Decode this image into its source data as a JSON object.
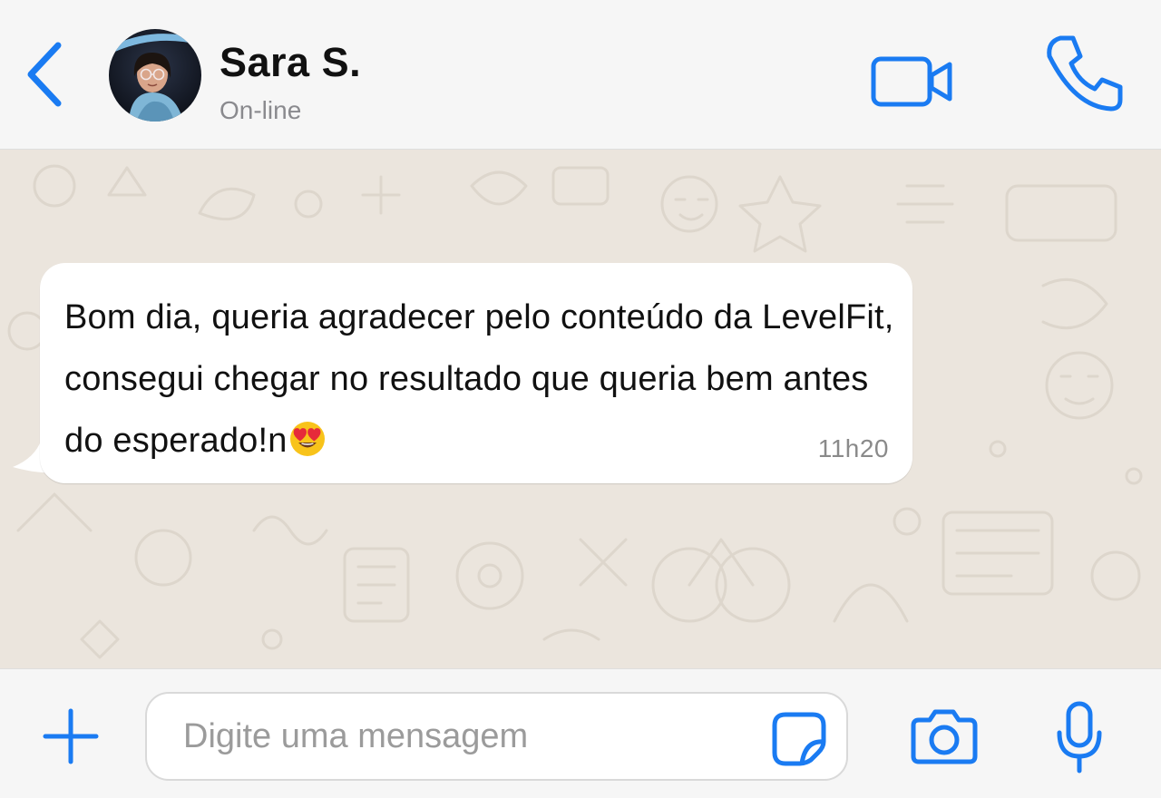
{
  "header": {
    "contact_name": "Sara S.",
    "status": "On-line",
    "back_icon": "chevron-left-icon",
    "video_icon": "video-camera-icon",
    "call_icon": "phone-icon"
  },
  "messages": [
    {
      "direction": "incoming",
      "text": "Bom dia, queria agradecer pelo conteúdo da LevelFit, consegui chegar no resultado que queria bem antes do esperado!n",
      "emoji": "😍",
      "time": "11h20"
    }
  ],
  "composer": {
    "placeholder": "Digite uma mensagem",
    "value": "",
    "plus_icon": "plus-icon",
    "sticker_icon": "sticker-icon",
    "camera_icon": "camera-icon",
    "mic_icon": "microphone-icon"
  },
  "colors": {
    "accent": "#1a7bf2",
    "chat_background": "#ebe5dd",
    "bar_background": "#f6f6f6",
    "bubble": "#ffffff",
    "status_text": "#8a8a8e"
  }
}
